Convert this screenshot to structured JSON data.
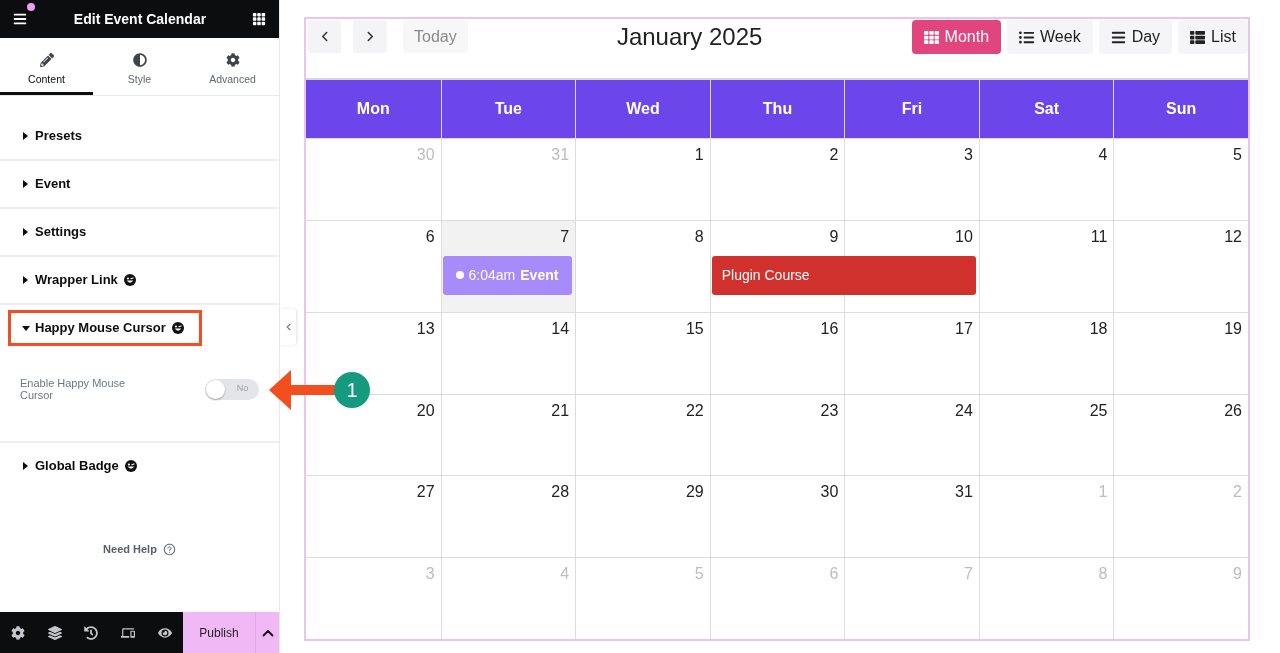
{
  "editor_panel": {
    "header": {
      "title": "Edit Event Calendar",
      "notification": true
    },
    "tabs": [
      {
        "label": "Content",
        "selected": true
      },
      {
        "label": "Style",
        "selected": false
      },
      {
        "label": "Advanced",
        "selected": false
      }
    ],
    "sections": [
      {
        "title": "Presets",
        "expanded": false,
        "highlighted": false,
        "emoji_icon": false
      },
      {
        "title": "Event",
        "expanded": false,
        "highlighted": false,
        "emoji_icon": false
      },
      {
        "title": "Settings",
        "expanded": false,
        "highlighted": false,
        "emoji_icon": false
      },
      {
        "title": "Wrapper Link",
        "expanded": false,
        "highlighted": false,
        "emoji_icon": true
      },
      {
        "title": "Happy Mouse Cursor",
        "expanded": true,
        "highlighted": true,
        "emoji_icon": true,
        "controls": [
          {
            "kind": "switch",
            "label": "Enable Happy Mouse Cursor",
            "on": false,
            "state_label": "No"
          }
        ]
      },
      {
        "title": "Global Badge",
        "expanded": false,
        "highlighted": false,
        "emoji_icon": true
      }
    ],
    "help_link": "Need Help",
    "footer": {
      "publish": "Publish"
    }
  },
  "callout": {
    "number": "1"
  },
  "calendar": {
    "toolbar": {
      "today_button": {
        "label": "Today",
        "disabled": true
      },
      "title": "January 2025",
      "views": [
        {
          "label": "Month",
          "selected": true
        },
        {
          "label": "Week",
          "selected": false
        },
        {
          "label": "Day",
          "selected": false
        },
        {
          "label": "List",
          "selected": false
        }
      ]
    },
    "weekdays": [
      "Mon",
      "Tue",
      "Wed",
      "Thu",
      "Fri",
      "Sat",
      "Sun"
    ],
    "weeks": [
      {
        "days": [
          {
            "number": "30",
            "other_month": true,
            "today": false
          },
          {
            "number": "31",
            "other_month": true,
            "today": false
          },
          {
            "number": "1",
            "other_month": false,
            "today": false
          },
          {
            "number": "2",
            "other_month": false,
            "today": false
          },
          {
            "number": "3",
            "other_month": false,
            "today": false
          },
          {
            "number": "4",
            "other_month": false,
            "today": false
          },
          {
            "number": "5",
            "other_month": false,
            "today": false
          }
        ]
      },
      {
        "days": [
          {
            "number": "6",
            "other_month": false,
            "today": false
          },
          {
            "number": "7",
            "other_month": false,
            "today": true,
            "events": [
              {
                "kind": "timed",
                "time": "6:04am",
                "title": "Event",
                "color": "#a78bfa",
                "spans_next_day": false
              }
            ]
          },
          {
            "number": "8",
            "other_month": false,
            "today": false
          },
          {
            "number": "9",
            "other_month": false,
            "today": false,
            "events": [
              {
                "kind": "all_day",
                "title": "Plugin Course",
                "color": "#d0312d",
                "spans_next_day": true
              }
            ]
          },
          {
            "number": "10",
            "other_month": false,
            "today": false
          },
          {
            "number": "11",
            "other_month": false,
            "today": false
          },
          {
            "number": "12",
            "other_month": false,
            "today": false
          }
        ]
      },
      {
        "days": [
          {
            "number": "13",
            "other_month": false,
            "today": false
          },
          {
            "number": "14",
            "other_month": false,
            "today": false
          },
          {
            "number": "15",
            "other_month": false,
            "today": false
          },
          {
            "number": "16",
            "other_month": false,
            "today": false
          },
          {
            "number": "17",
            "other_month": false,
            "today": false
          },
          {
            "number": "18",
            "other_month": false,
            "today": false
          },
          {
            "number": "19",
            "other_month": false,
            "today": false
          }
        ]
      },
      {
        "days": [
          {
            "number": "20",
            "other_month": false,
            "today": false
          },
          {
            "number": "21",
            "other_month": false,
            "today": false
          },
          {
            "number": "22",
            "other_month": false,
            "today": false
          },
          {
            "number": "23",
            "other_month": false,
            "today": false
          },
          {
            "number": "24",
            "other_month": false,
            "today": false
          },
          {
            "number": "25",
            "other_month": false,
            "today": false
          },
          {
            "number": "26",
            "other_month": false,
            "today": false
          }
        ]
      },
      {
        "days": [
          {
            "number": "27",
            "other_month": false,
            "today": false
          },
          {
            "number": "28",
            "other_month": false,
            "today": false
          },
          {
            "number": "29",
            "other_month": false,
            "today": false
          },
          {
            "number": "30",
            "other_month": false,
            "today": false
          },
          {
            "number": "31",
            "other_month": false,
            "today": false
          },
          {
            "number": "1",
            "other_month": true,
            "today": false
          },
          {
            "number": "2",
            "other_month": true,
            "today": false
          }
        ]
      },
      {
        "days": [
          {
            "number": "3",
            "other_month": true,
            "today": false
          },
          {
            "number": "4",
            "other_month": true,
            "today": false
          },
          {
            "number": "5",
            "other_month": true,
            "today": false
          },
          {
            "number": "6",
            "other_month": true,
            "today": false
          },
          {
            "number": "7",
            "other_month": true,
            "today": false
          },
          {
            "number": "8",
            "other_month": true,
            "today": false
          },
          {
            "number": "9",
            "other_month": true,
            "today": false
          }
        ]
      }
    ]
  }
}
